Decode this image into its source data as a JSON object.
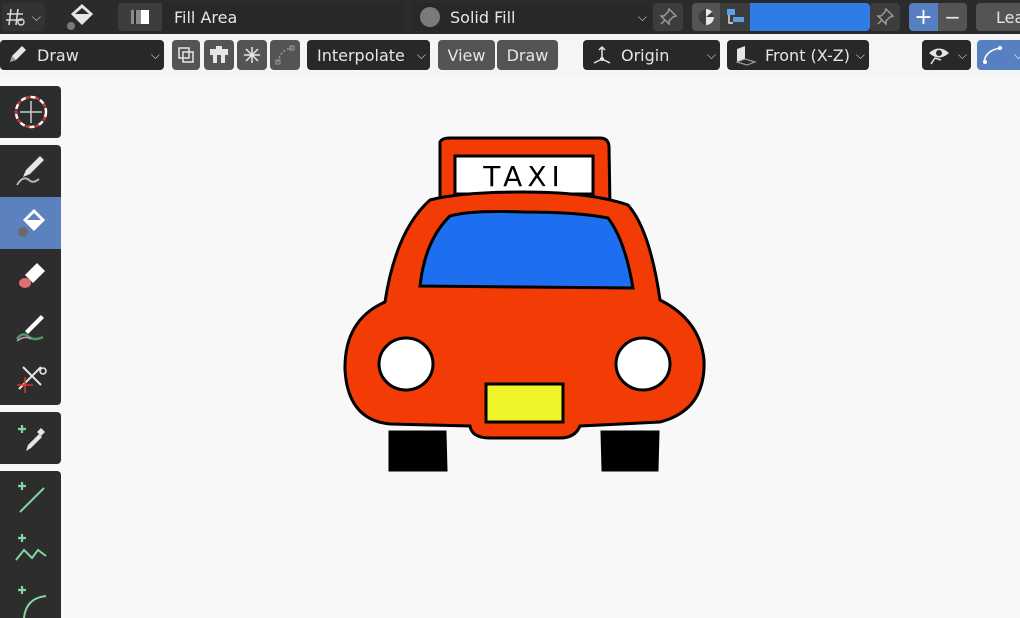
{
  "header": {
    "material_name": "Fill Area",
    "fill_mode": "Solid Fill",
    "truncated_label": "Lea",
    "plus_label": "+",
    "minus_label": "−",
    "accent_color": "#5680c2",
    "active_field_color": "#2f7ce5"
  },
  "toolbar_row": {
    "mode": "Draw",
    "interpolate": "Interpolate",
    "view_button": "View",
    "draw_button": "Draw",
    "origin": "Origin",
    "view_plane": "Front (X-Z)"
  },
  "tools": [
    {
      "name": "cursor-tool",
      "icon": "cursor-icon",
      "active": false
    },
    {
      "name": "draw-tool",
      "icon": "pencil-icon",
      "active": false
    },
    {
      "name": "fill-tool",
      "icon": "bucket-icon",
      "active": true
    },
    {
      "name": "erase-tool",
      "icon": "eraser-icon",
      "active": false
    },
    {
      "name": "tint-tool",
      "icon": "brush-icon",
      "active": false
    },
    {
      "name": "cutter-tool",
      "icon": "scissors-icon",
      "active": false
    },
    {
      "name": "eyedropper-tool",
      "icon": "eyedropper-icon",
      "active": false
    },
    {
      "name": "line-tool",
      "icon": "line-icon",
      "active": false
    },
    {
      "name": "polyline-tool",
      "icon": "polyline-icon",
      "active": false
    },
    {
      "name": "arc-tool",
      "icon": "arc-icon",
      "active": false
    }
  ],
  "drawing": {
    "sign_text": "TAXI",
    "body_color": "#f23b05",
    "window_color": "#1e6ef0",
    "plate_color": "#eef52a",
    "outline_color": "#000000",
    "wheel_color": "#000000",
    "light_color": "#ffffff"
  }
}
